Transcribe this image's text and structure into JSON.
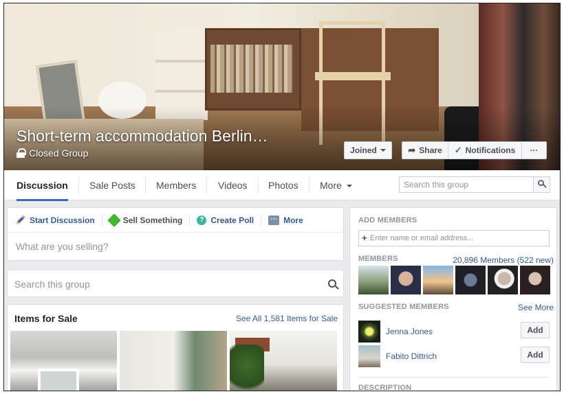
{
  "cover": {
    "title": "Short-term accommodation Berlin…",
    "privacy": "Closed Group",
    "buttons": {
      "joined": "Joined",
      "share": "Share",
      "notifications": "Notifications",
      "more": "···"
    },
    "icons": {
      "privacy": "lock-icon",
      "share": "share-arrow-icon",
      "notifications": "check-icon"
    }
  },
  "tabs": {
    "items": [
      "Discussion",
      "Sale Posts",
      "Members",
      "Videos",
      "Photos",
      "More"
    ],
    "active": "Discussion",
    "search_placeholder": "Search this group"
  },
  "composer": {
    "actions": [
      "Start Discussion",
      "Sell Something",
      "Create Poll",
      "More"
    ],
    "placeholder": "What are you selling?"
  },
  "group_search": {
    "placeholder": "Search this group"
  },
  "items_for_sale": {
    "title": "Items for Sale",
    "see_all": "See All 1,581 Items for Sale"
  },
  "sidebar": {
    "add_members": {
      "heading": "ADD MEMBERS",
      "placeholder": "Enter name or email address..."
    },
    "members": {
      "heading": "MEMBERS",
      "count": "20,896 Members (522 new)"
    },
    "suggested": {
      "heading": "SUGGESTED MEMBERS",
      "see_more": "See More",
      "people": [
        {
          "name": "Jenna Jones",
          "button": "Add"
        },
        {
          "name": "Fabito Dittrich",
          "button": "Add"
        }
      ]
    },
    "description": {
      "heading": "DESCRIPTION"
    }
  },
  "colors": {
    "link": "#365899",
    "accent": "#4267b2",
    "page_bg": "#e9ebee"
  }
}
